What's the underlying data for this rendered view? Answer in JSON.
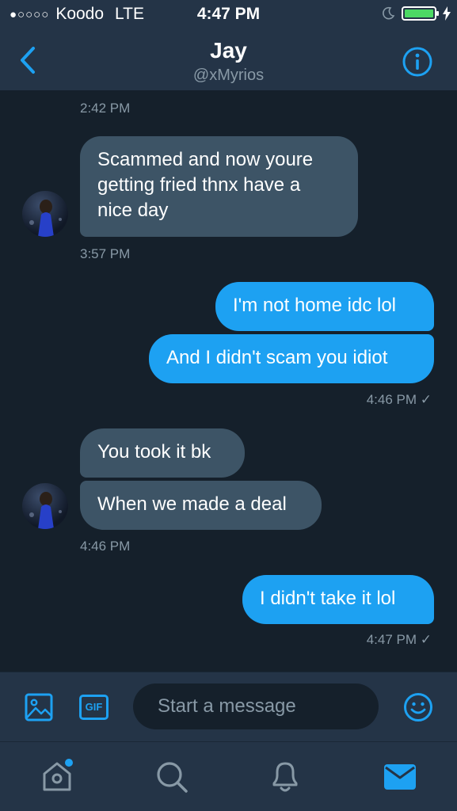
{
  "status_bar": {
    "signal": "●○○○○",
    "carrier": "Koodo",
    "network": "LTE",
    "time": "4:47 PM",
    "battery_color": "#4cd964"
  },
  "header": {
    "title": "Jay",
    "handle": "@xMyrios"
  },
  "messages": [
    {
      "type": "timestamp",
      "text": "2:42 PM"
    },
    {
      "type": "received",
      "lines": [
        "Scammed and now youre",
        "getting fried thnx have a",
        "nice day"
      ]
    },
    {
      "type": "timestamp",
      "text": "3:57 PM"
    },
    {
      "type": "sent",
      "text": "I'm not home idc lol"
    },
    {
      "type": "sent",
      "text": "And I didn't scam you idiot"
    },
    {
      "type": "timestamp",
      "text": "4:46 PM ✓"
    },
    {
      "type": "received",
      "text": "You took it bk"
    },
    {
      "type": "received",
      "text": "When we made a deal"
    },
    {
      "type": "timestamp",
      "text": "4:46 PM"
    },
    {
      "type": "sent",
      "text": "I didn't take it lol"
    },
    {
      "type": "timestamp",
      "text": "4:47 PM ✓"
    }
  ],
  "composer": {
    "placeholder": "Start a message",
    "gif_label": "GIF"
  },
  "tabs": [
    "home-icon",
    "search-icon",
    "notifications-icon",
    "messages-icon"
  ],
  "colors": {
    "accent": "#1da1f2",
    "background": "#15202b",
    "panel": "#243447",
    "received_bubble": "#3d5466",
    "muted": "#8899a6"
  }
}
